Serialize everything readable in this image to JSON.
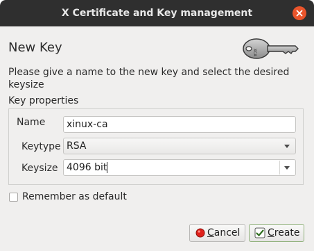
{
  "window": {
    "title": "X Certificate and Key management"
  },
  "header": {
    "heading": "New Key",
    "description": "Please give a name to the new key and select the desired keysize",
    "icon": "key-icon"
  },
  "key_properties": {
    "group_title": "Key properties",
    "name_label": "Name",
    "name_value": "xinux-ca",
    "keytype_label": "Keytype",
    "keytype_value": "RSA",
    "keysize_label": "Keysize",
    "keysize_value": "4096 bit"
  },
  "remember": {
    "label": "Remember as default",
    "checked": false
  },
  "buttons": {
    "cancel_label": "Cancel",
    "create_label": "Create"
  },
  "colors": {
    "titlebar": "#2f2f2f",
    "close_accent": "#e9542b",
    "window_bg": "#f0efee"
  }
}
